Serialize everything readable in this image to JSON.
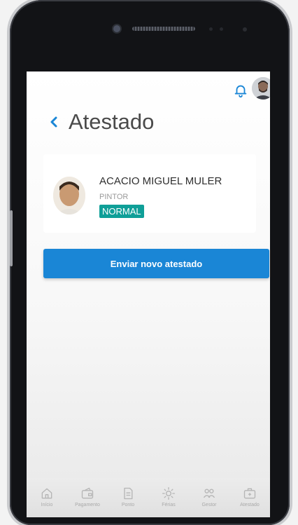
{
  "page": {
    "title": "Atestado"
  },
  "employee": {
    "name": "ACACIO MIGUEL MULER",
    "role": "PINTOR",
    "status": "NORMAL"
  },
  "actions": {
    "send_label": "Enviar novo atestado"
  },
  "tabs": [
    {
      "label": "Início",
      "icon": "home-icon"
    },
    {
      "label": "Pagamento",
      "icon": "wallet-icon"
    },
    {
      "label": "Ponto",
      "icon": "document-icon"
    },
    {
      "label": "Férias",
      "icon": "sun-icon"
    },
    {
      "label": "Gestor",
      "icon": "people-icon"
    },
    {
      "label": "Atestado",
      "icon": "medical-kit-icon"
    }
  ],
  "colors": {
    "accent": "#1a86d6",
    "status_badge": "#0f9f98",
    "back_arrow": "#1a86d6"
  }
}
